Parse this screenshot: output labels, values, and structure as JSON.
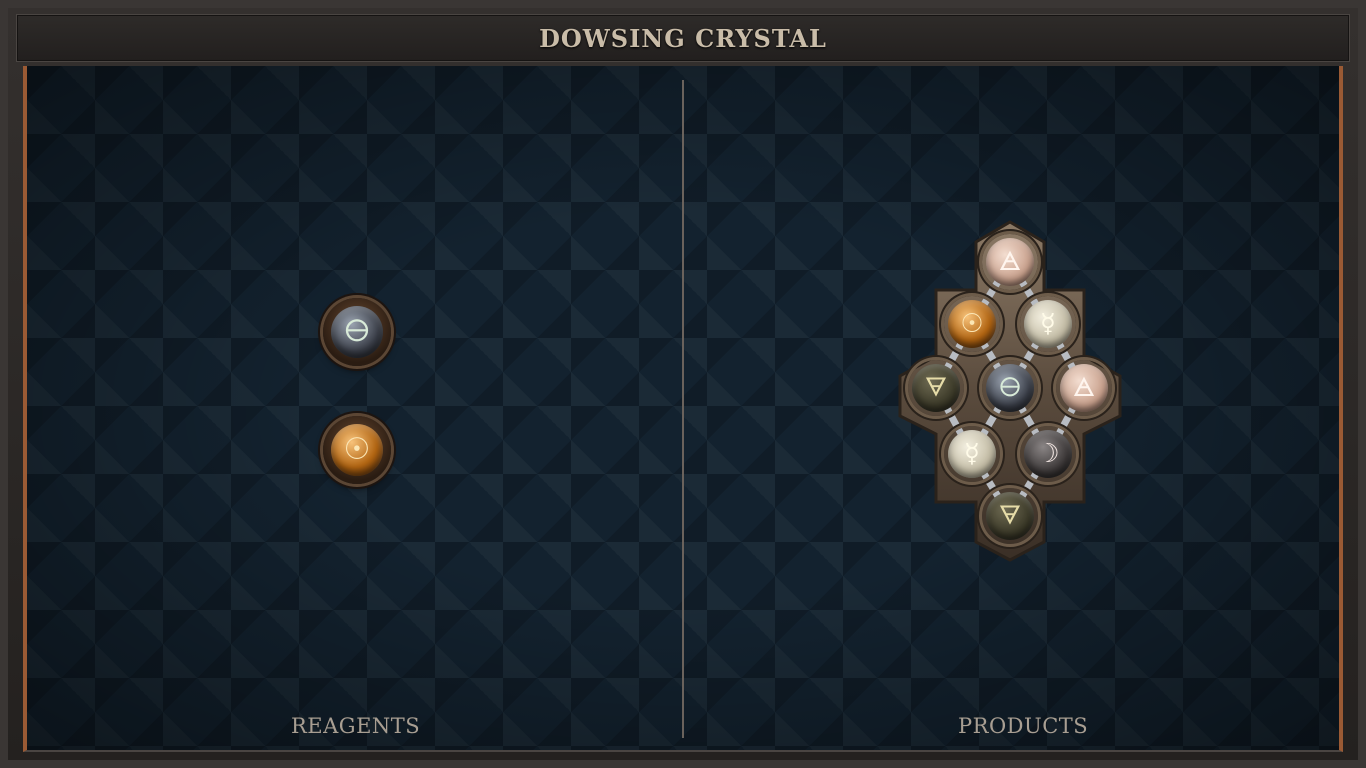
{
  "window": {
    "title": "DOWSING CRYSTAL"
  },
  "sections": {
    "left_label": "REAGENTS",
    "right_label": "PRODUCTS"
  },
  "reagents": [
    {
      "element": "salt",
      "icon": "salt-icon",
      "glyph": "🜔"
    },
    {
      "element": "gold",
      "icon": "gold-icon",
      "glyph": "☉"
    }
  ],
  "products": [
    {
      "element": "air",
      "icon": "air-icon",
      "glyph": "🜁"
    },
    {
      "element": "gold",
      "icon": "gold-icon",
      "glyph": "☉"
    },
    {
      "element": "quicksilver",
      "icon": "quicksilver-icon",
      "glyph": "☿"
    },
    {
      "element": "earth",
      "icon": "earth-icon",
      "glyph": "🜃"
    },
    {
      "element": "salt",
      "icon": "salt-icon",
      "glyph": "🜔"
    },
    {
      "element": "air",
      "icon": "air-icon",
      "glyph": "🜁"
    },
    {
      "element": "quicksilver",
      "icon": "quicksilver-icon",
      "glyph": "☿"
    },
    {
      "element": "silver",
      "icon": "silver-icon",
      "glyph": "☽"
    },
    {
      "element": "earth",
      "icon": "earth-icon",
      "glyph": "🜃"
    }
  ],
  "colors": {
    "frame": "#3a3634",
    "board": "#13222f",
    "accent_copper": "#9a5a34",
    "label_text": "#a89e92",
    "title_text": "#c9bca8"
  }
}
